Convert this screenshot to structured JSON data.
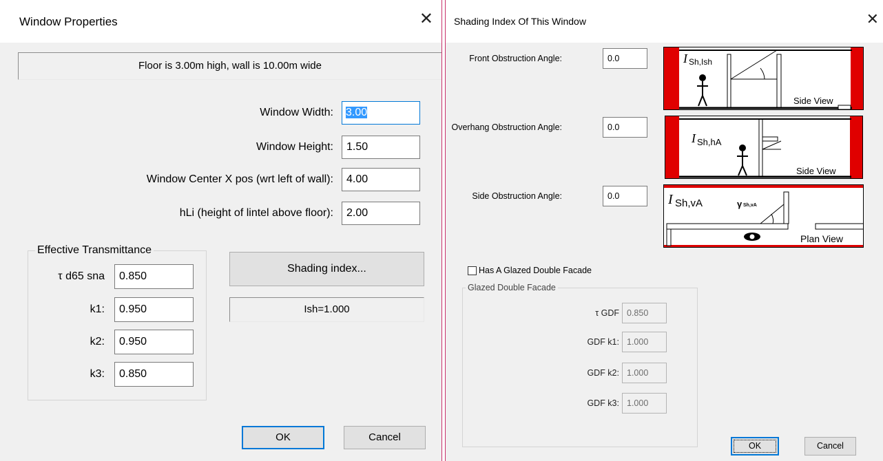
{
  "window_properties": {
    "title": "Window Properties",
    "info": "Floor is 3.00m high, wall is 10.00m wide",
    "fields": {
      "width_label": "Window Width:",
      "width_value": "3.00",
      "height_label": "Window Height:",
      "height_value": "1.50",
      "center_label": "Window Center X pos (wrt left of wall):",
      "center_value": "4.00",
      "lintel_label": "hLi (height of lintel above floor):",
      "lintel_value": "2.00"
    },
    "transmittance": {
      "group_label": "Effective Transmittance",
      "tau_label": "τ d65 sna",
      "tau_value": "0.850",
      "k1_label": "k1:",
      "k1_value": "0.950",
      "k2_label": "k2:",
      "k2_value": "0.950",
      "k3_label": "k3:",
      "k3_value": "0.850"
    },
    "shading_button": "Shading index...",
    "ish_display": "Ish=1.000",
    "ok_label": "OK",
    "cancel_label": "Cancel"
  },
  "shading_dialog": {
    "title": "Shading Index Of This Window",
    "front_label": "Front Obstruction Angle:",
    "front_value": "0.0",
    "overhang_label": "Overhang Obstruction Angle:",
    "overhang_value": "0.0",
    "side_label": "Side Obstruction Angle:",
    "side_value": "0.0",
    "diagrams": {
      "front_symbol": "I",
      "front_subscript": "Sh,Ish",
      "front_caption": "Side View",
      "overhang_symbol": "I",
      "overhang_subscript": "Sh,hA",
      "overhang_caption": "Side View",
      "side_symbol": "I",
      "side_subscript": "Sh,vA",
      "side_caption": "Plan View",
      "side_gamma": "γ",
      "side_gamma_sub": "Sh,vA"
    },
    "gdf_checkbox_label": "Has A Glazed Double Facade",
    "gdf_checked": false,
    "gdf_group_label": "Glazed Double Facade",
    "gdf_tau_label": "τ GDF",
    "gdf_tau_value": "0.850",
    "gdf_k1_label": "GDF k1:",
    "gdf_k1_value": "1.000",
    "gdf_k2_label": "GDF k2:",
    "gdf_k2_value": "1.000",
    "gdf_k3_label": "GDF k3:",
    "gdf_k3_value": "1.000",
    "ok_label": "OK",
    "cancel_label": "Cancel"
  },
  "colors": {
    "accent": "#0078d7",
    "diagram_red": "#e00000",
    "selection": "#3399ff"
  }
}
